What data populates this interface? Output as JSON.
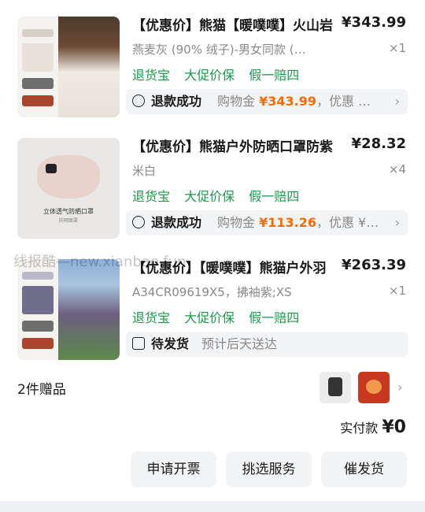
{
  "items": [
    {
      "title": "【优惠价】熊猫【暖噗噗】火山岩",
      "price": "¥343.99",
      "variant": "燕麦灰 (90% 绒子)-男女同款 (…",
      "qty": "×1",
      "tags": [
        "退货宝",
        "大促价保",
        "假一赔四"
      ],
      "status": "退款成功",
      "status_note_prefix": "购物金 ",
      "status_amount": "¥343.99",
      "status_note_suffix": "，优惠 …",
      "thumb_labels": [
        "790蓬大卡照暖",
        "极寒充实暖羽"
      ]
    },
    {
      "title": "【优惠价】熊猫户外防晒口罩防紫",
      "price": "¥28.32",
      "variant": "米白",
      "qty": "×4",
      "tags": [
        "退货宝",
        "大促价保",
        "假一赔四"
      ],
      "status": "退款成功",
      "status_note_prefix": "购物金 ",
      "status_amount": "¥113.26",
      "status_note_suffix": "，优惠 ¥…",
      "thumb_caption": "立体透气防晒口罩",
      "thumb_subcaption": "防晒面罩"
    },
    {
      "title": "【优惠价】【暖噗噗】熊猫户外羽",
      "price": "¥263.39",
      "variant": "A34CR09619X5，拂袖紫;XS",
      "qty": "×1",
      "tags": [
        "退货宝",
        "大促价保",
        "假一赔四"
      ],
      "status": "待发货",
      "status_note": "预计后天送达",
      "thumb_labels": [
        "790蓬大卡照暖",
        "冰山蓝色暖羽"
      ]
    }
  ],
  "gifts": {
    "label": "2件赠品"
  },
  "payment": {
    "label": "实付款 ",
    "amount": "¥0"
  },
  "actions": {
    "invoice": "申请开票",
    "service": "挑选服务",
    "urge": "催发货"
  },
  "watermark": "线报酷—new.xianbao.fun"
}
